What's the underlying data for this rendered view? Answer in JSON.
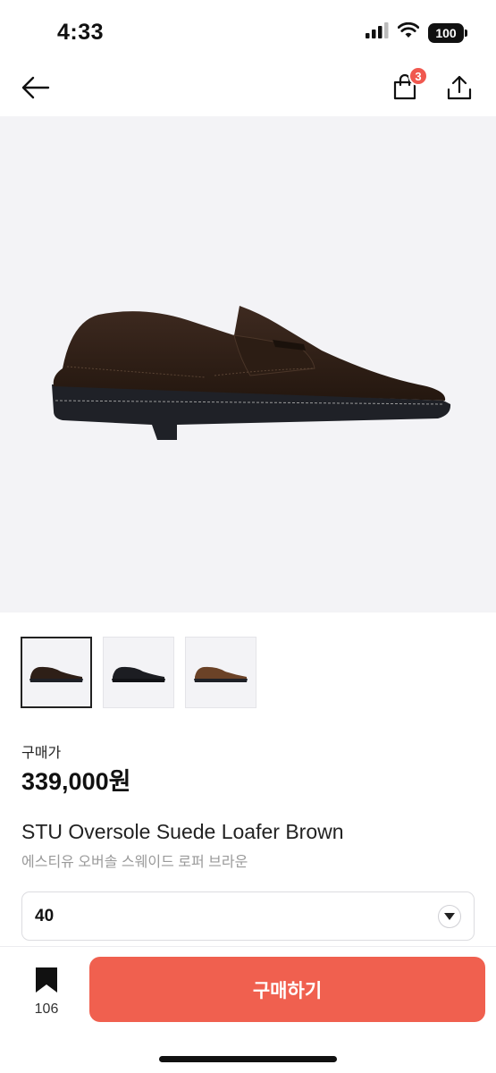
{
  "status_bar": {
    "time": "4:33",
    "battery": "100",
    "icons": [
      "signal-icon",
      "wifi-icon",
      "battery-icon"
    ]
  },
  "nav": {
    "back_icon": "back-arrow-icon",
    "cart_icon": "shopping-bag-icon",
    "cart_count": "3",
    "share_icon": "share-icon"
  },
  "product": {
    "thumbnails": [
      "dark-brown-loafer",
      "black-loafer",
      "brown-loafer"
    ],
    "active_thumbnail": 0,
    "price_label": "구매가",
    "price": "339,000원",
    "title_en": "STU Oversole Suede Loafer Brown",
    "title_ko": "에스티유 오버솔 스웨이드 로퍼 브라운",
    "size_selected": "40"
  },
  "bottom_bar": {
    "bookmark_count": "106",
    "buy_label": "구매하기"
  },
  "colors": {
    "accent": "#f0604f",
    "badge": "#f0584f",
    "image_bg": "#f3f3f6"
  }
}
